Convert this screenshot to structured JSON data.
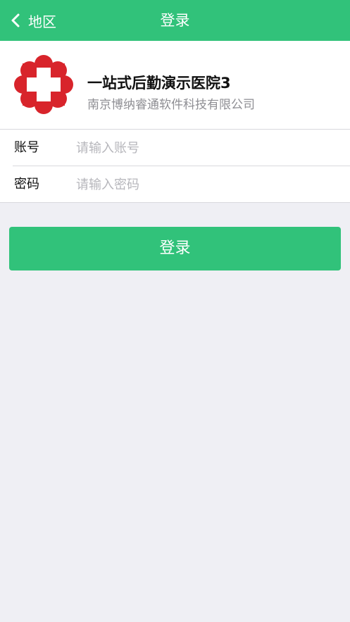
{
  "navbar": {
    "back_label": "地区",
    "title": "登录",
    "background_color": "#31c27a",
    "back_icon": "chevron-left-icon"
  },
  "header": {
    "logo_icon": "red-cross-hospital-logo",
    "hospital_name": "一站式后勤演示医院3",
    "company_name": "南京博纳睿通软件科技有限公司"
  },
  "form": {
    "account": {
      "label": "账号",
      "value": "",
      "placeholder": "请输入账号"
    },
    "password": {
      "label": "密码",
      "value": "",
      "placeholder": "请输入密码"
    }
  },
  "login_button": {
    "label": "登录",
    "color": "#31c27a"
  }
}
